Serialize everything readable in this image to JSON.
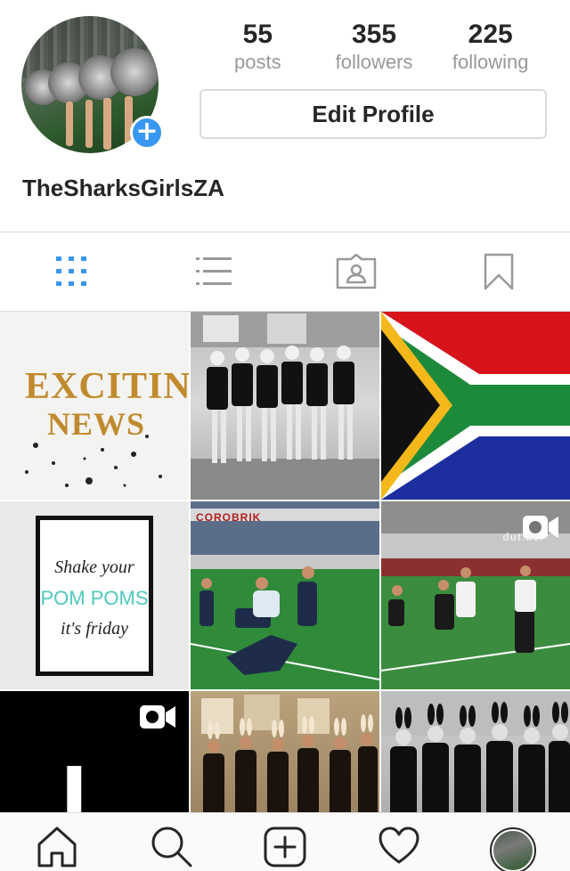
{
  "profile": {
    "username": "TheSharksGirlsZA",
    "stats": [
      {
        "value": "55",
        "label": "posts"
      },
      {
        "value": "355",
        "label": "followers"
      },
      {
        "value": "225",
        "label": "following"
      }
    ],
    "edit_profile_label": "Edit Profile",
    "add_badge_symbol": "+"
  },
  "tabs": [
    {
      "name": "grid-view",
      "icon": "grid-icon",
      "active": true
    },
    {
      "name": "list-view",
      "icon": "list-icon",
      "active": false
    },
    {
      "name": "tagged",
      "icon": "tagged-person-icon",
      "active": false
    },
    {
      "name": "saved",
      "icon": "bookmark-icon",
      "active": false
    }
  ],
  "posts": {
    "exciting_news": {
      "line1": "EXCITING",
      "line2": "NEWS"
    },
    "poster": {
      "line1": "Shake your",
      "line2": "POM POMS",
      "line3": "it's friday"
    },
    "video_letter": "L.",
    "banner_text": "COROBRIK",
    "banner_text_2": "dut.ac."
  },
  "bottom_nav": [
    {
      "name": "home",
      "icon": "home-icon"
    },
    {
      "name": "search",
      "icon": "search-icon"
    },
    {
      "name": "new-post",
      "icon": "plus-square-icon"
    },
    {
      "name": "activity",
      "icon": "heart-icon"
    },
    {
      "name": "profile",
      "icon": "profile-avatar-icon"
    }
  ],
  "colors": {
    "accent_blue": "#3897f0",
    "text_primary": "#262626",
    "text_secondary": "#999999",
    "border": "#dbdbdb"
  }
}
